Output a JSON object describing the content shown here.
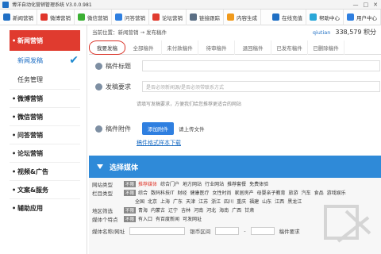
{
  "window": {
    "title": "博洋自动化营销管理系统 V3.0.0.981",
    "controls": [
      "—",
      "□",
      "✕"
    ]
  },
  "toolbar": {
    "items": [
      {
        "label": "新闻营销",
        "icon": "news-icon",
        "color": "#1f6fc4"
      },
      {
        "label": "微博营销",
        "icon": "weibo-icon",
        "color": "#e0352b"
      },
      {
        "label": "微信营销",
        "icon": "wechat-icon",
        "color": "#3cb034"
      },
      {
        "label": "问答营销",
        "icon": "qa-icon",
        "color": "#2f7fe0"
      },
      {
        "label": "论坛营销",
        "icon": "forum-icon",
        "color": "#e03b2f"
      },
      {
        "label": "链接跟踪",
        "icon": "link-icon",
        "color": "#5a6e84"
      },
      {
        "label": "内容生成",
        "icon": "content-icon",
        "color": "#f09a1c"
      },
      {
        "label": "在线充值",
        "icon": "recharge-icon",
        "color": "#1f6fc4"
      },
      {
        "label": "帮助中心",
        "icon": "help-icon",
        "color": "#2aa7d8"
      },
      {
        "label": "用户中心",
        "icon": "user-icon",
        "color": "#2f7fe0"
      }
    ]
  },
  "sidebar": {
    "header": "新闻营销",
    "subitems": [
      {
        "label": "新闻发稿",
        "active": true
      },
      {
        "label": "任务管理",
        "active": false
      }
    ],
    "categories": [
      "微博营销",
      "微信营销",
      "问答营销",
      "论坛营销",
      "视频&广告",
      "文案&服务",
      "辅助应用"
    ]
  },
  "breadcrumb": "当前位置：新闻营销 → 发布稿件",
  "user": {
    "name": "qiutian",
    "balance": "338,579 积分"
  },
  "tabs": [
    "我要发稿",
    "全部稿件",
    "未付款稿件",
    "待审稿件",
    "退回稿件",
    "已发布稿件",
    "已删除稿件"
  ],
  "form": {
    "title_label": "稿件标题",
    "request_label": "发稿要求",
    "request_placeholder": "是否必须新闻源/是否必须带联系方式",
    "request_tip": "请填写发稿要求，方便我们给您推荐更适合的网站",
    "attach_label": "稿件附件",
    "add_button": "添加附件",
    "upload_hint": "请上传文件",
    "template_link": "稿件格式样本下载"
  },
  "media": {
    "title": "选择媒体",
    "filters": [
      {
        "label": "网站类型",
        "badge": "不限",
        "options": [
          [
            "推荐媒体",
            true
          ],
          [
            "综合门户",
            false
          ],
          [
            "地方网站",
            false
          ],
          [
            "行业网站",
            false
          ],
          [
            "推荐套餐",
            false
          ],
          [
            "免费体验",
            false
          ]
        ]
      },
      {
        "label": "栏目类型",
        "badge": "不限",
        "options": [
          [
            "综合",
            false
          ],
          [
            "数码科技IT",
            false
          ],
          [
            "财经",
            false
          ],
          [
            "健康医疗",
            false
          ],
          [
            "女性时尚",
            false
          ],
          [
            "家居房产",
            false
          ],
          [
            "母婴亲子教育",
            false
          ],
          [
            "旅游",
            false
          ],
          [
            "汽车",
            false
          ],
          [
            "食品",
            false
          ],
          [
            "游戏娱乐",
            false
          ]
        ]
      },
      {
        "label": "",
        "badge": "",
        "options": [
          [
            "全国",
            false
          ],
          [
            "北京",
            false
          ],
          [
            "上海",
            false
          ],
          [
            "广东",
            false
          ],
          [
            "天津",
            false
          ],
          [
            "江苏",
            false
          ],
          [
            "浙江",
            false
          ],
          [
            "四川",
            false
          ],
          [
            "重庆",
            false
          ],
          [
            "福建",
            false
          ],
          [
            "山东",
            false
          ],
          [
            "江西",
            false
          ],
          [
            "黑龙江",
            false
          ]
        ]
      },
      {
        "label": "地区筛选",
        "badge": "不限",
        "options": [
          [
            "青海",
            false
          ],
          [
            "内蒙古",
            false
          ],
          [
            "辽宁",
            false
          ],
          [
            "吉林",
            false
          ],
          [
            "河南",
            false
          ],
          [
            "河北",
            false
          ],
          [
            "海南",
            false
          ],
          [
            "广西",
            false
          ],
          [
            "甘肃",
            false
          ]
        ]
      },
      {
        "label": "媒体个特点",
        "badge": "不限",
        "options": [
          [
            "有入口",
            false
          ],
          [
            "有百度新闻",
            false
          ],
          [
            "可发网址",
            false
          ]
        ]
      }
    ],
    "search": {
      "name_label": "媒体名称/网址",
      "price_label": "银币区间",
      "dash": "-",
      "req_label": "稿件要求"
    }
  }
}
